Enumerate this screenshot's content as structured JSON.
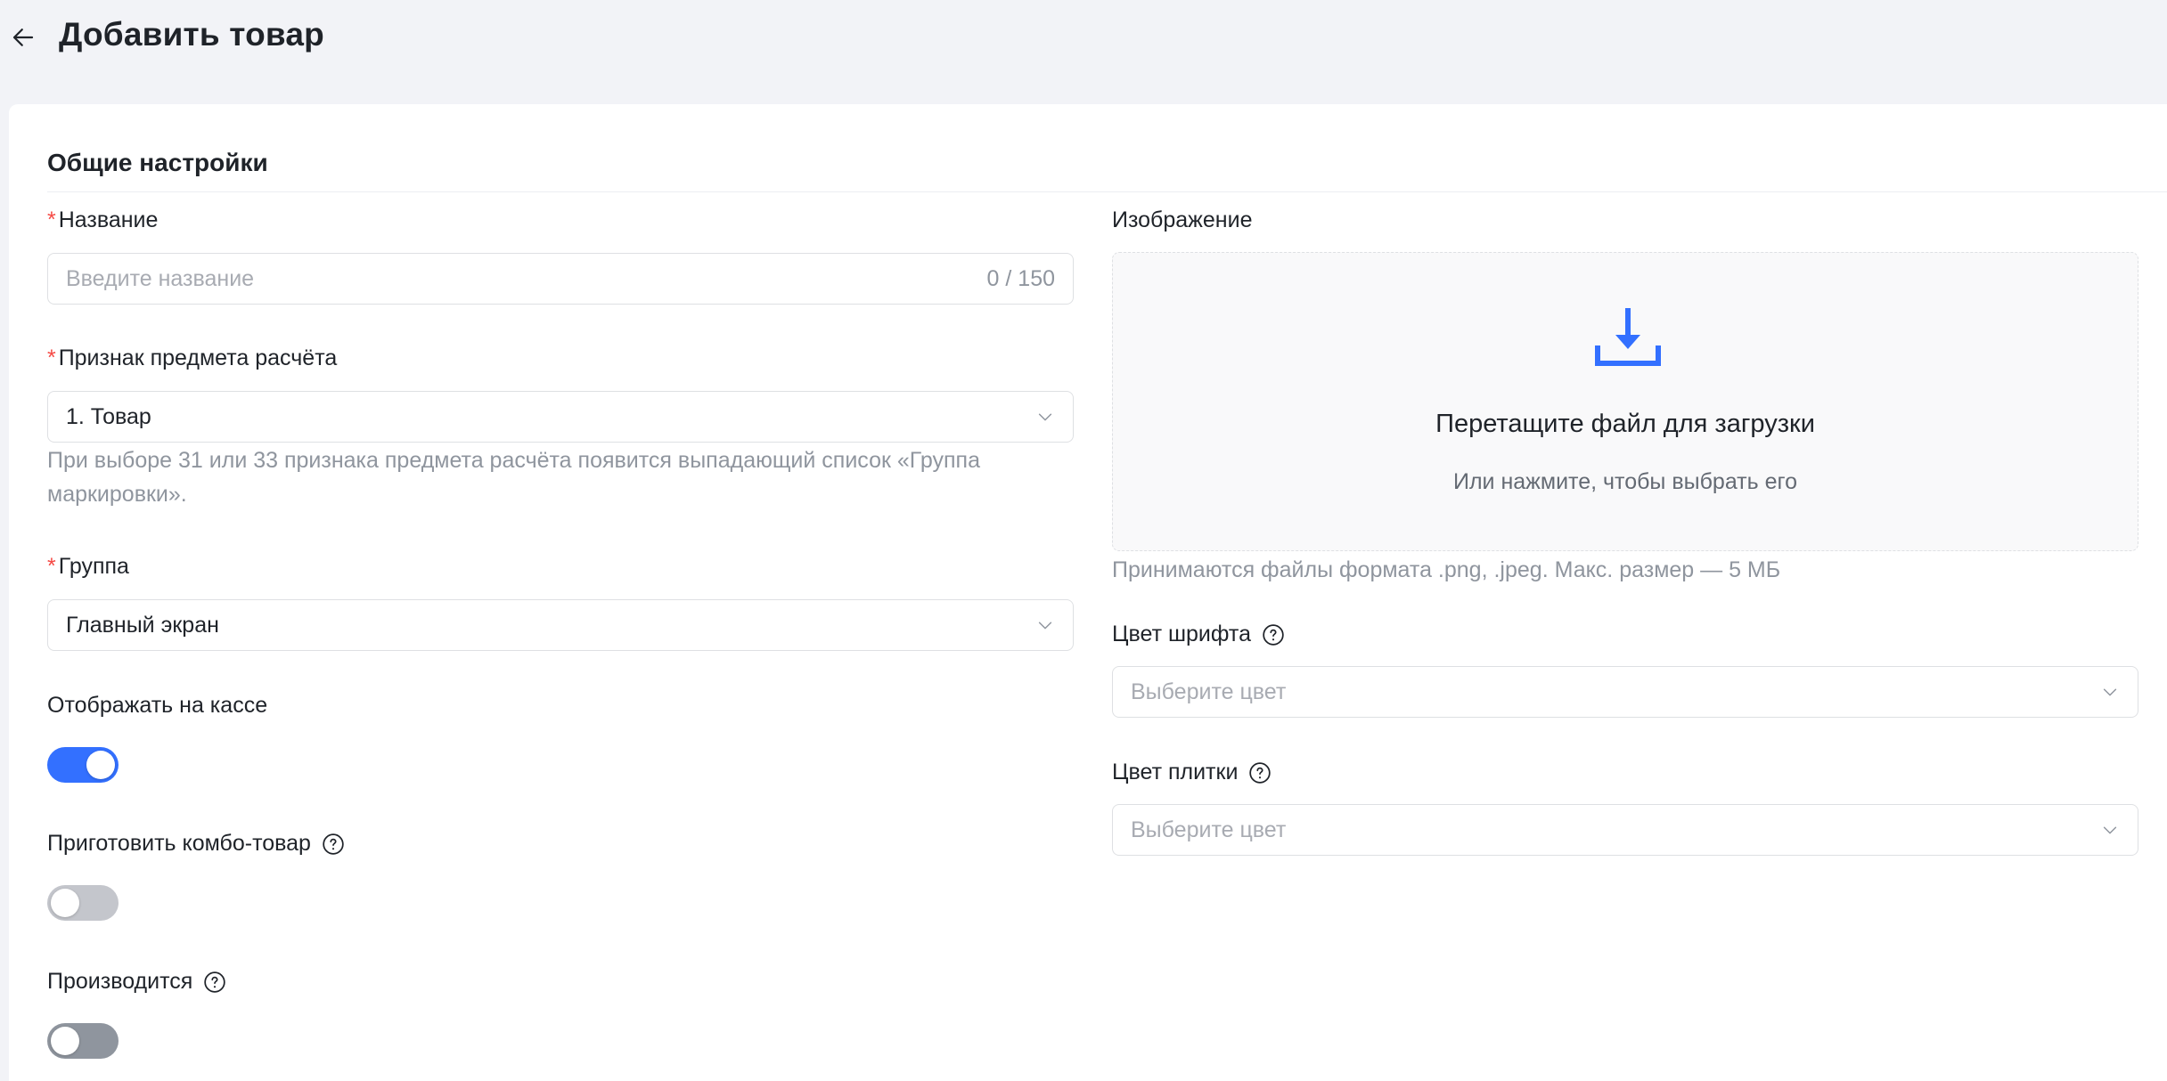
{
  "header": {
    "title": "Добавить товар"
  },
  "section": {
    "title": "Общие настройки"
  },
  "name_field": {
    "label": "Название",
    "placeholder": "Введите название",
    "value": "",
    "counter": "0 / 150"
  },
  "payment_subject_field": {
    "label": "Признак предмета расчёта",
    "value": "1. Товар",
    "hint": "При выборе 31 или 33 признака предмета расчёта появится выпадающий список «Группа маркировки»."
  },
  "group_field": {
    "label": "Группа",
    "value": "Главный экран"
  },
  "show_at_register": {
    "label": "Отображать на кассе",
    "enabled": true
  },
  "combo_product": {
    "label": "Приготовить комбо-товар",
    "enabled": false
  },
  "produced": {
    "label": "Производится",
    "enabled": false
  },
  "image_field": {
    "label": "Изображение",
    "upload_title": "Перетащите файл для загрузки",
    "upload_subtitle": "Или нажмите, чтобы выбрать его",
    "hint": "Принимаются файлы формата .png, .jpeg. Макс. размер — 5 МБ"
  },
  "font_color_field": {
    "label": "Цвет шрифта",
    "placeholder": "Выберите цвет"
  },
  "tile_color_field": {
    "label": "Цвет плитки",
    "placeholder": "Выберите цвет"
  },
  "colors": {
    "accent": "#3370ff",
    "required": "#f54a45",
    "background": "#f2f3f7"
  },
  "icons": {
    "back": "arrow-left-icon",
    "help": "question-circle-icon",
    "chevron": "chevron-down-icon",
    "upload": "download-tray-icon"
  }
}
